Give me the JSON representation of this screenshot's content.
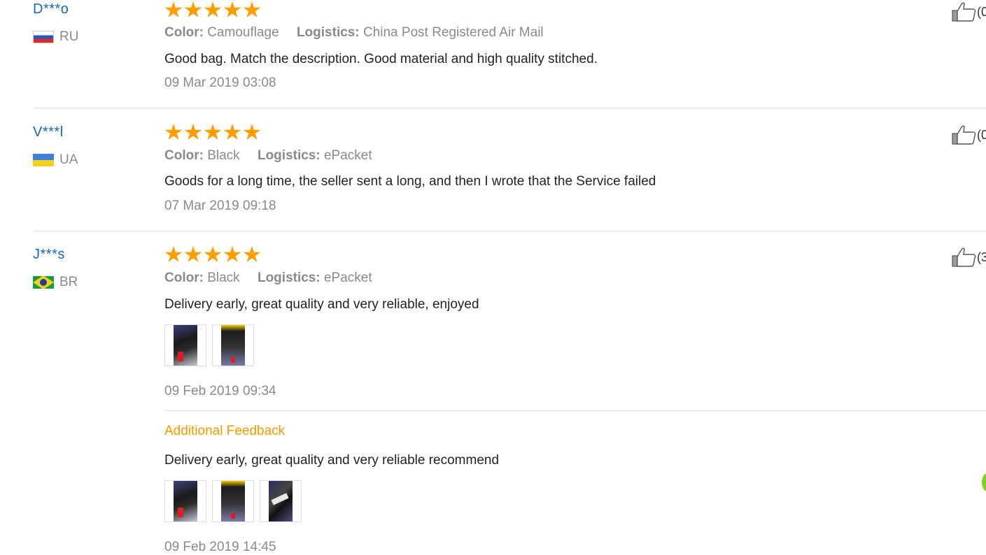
{
  "reviews": [
    {
      "user": "D***o",
      "country": "RU",
      "flag": "russia-flag",
      "rating": 5,
      "color_label": "Color:",
      "color_value": "Camouflage",
      "logistics_label": "Logistics:",
      "logistics_value": "China Post Registered Air Mail",
      "text": "Good bag. Match the description. Good material and high quality stitched.",
      "date": "09 Mar 2019 03:08",
      "likes": "(0"
    },
    {
      "user": "V***l",
      "country": "UA",
      "flag": "ukraine-flag",
      "rating": 5,
      "color_label": "Color:",
      "color_value": "Black",
      "logistics_label": "Logistics:",
      "logistics_value": "ePacket",
      "text": "Goods for a long time, the seller sent a long, and then I wrote that the Service failed",
      "date": "07 Mar 2019 09:18",
      "likes": "(0"
    },
    {
      "user": "J***s",
      "country": "BR",
      "flag": "brazil-flag",
      "rating": 5,
      "color_label": "Color:",
      "color_value": "Black",
      "logistics_label": "Logistics:",
      "logistics_value": "ePacket",
      "text": "Delivery early, great quality and very reliable, enjoyed",
      "date": "09 Feb 2019 09:34",
      "likes": "(3",
      "additional_title": "Additional Feedback",
      "additional_text": "Delivery early, great quality and very reliable recommend",
      "additional_date": "09 Feb 2019 14:45"
    }
  ],
  "colors": {
    "username": "#1a66b3",
    "star": "#ff9c00",
    "additional": "#f39a00",
    "muted": "#8a8a8a"
  },
  "icons": {
    "like": "thumbs-up-icon",
    "star": "star-icon"
  }
}
